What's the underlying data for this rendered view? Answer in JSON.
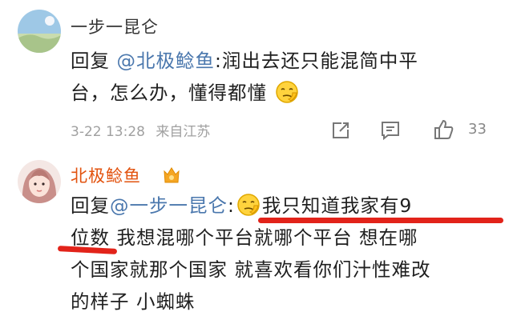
{
  "comments": [
    {
      "username": "一步一昆仑",
      "reply_prefix": "回复 ",
      "mention": "@北极鲶鱼",
      "text_line1": ":润出去还只能混简中平",
      "text_line2": "台，怎么办，懂得都懂",
      "timestamp": "3-22 13:28",
      "source": "来自江苏",
      "like_count": "33",
      "icons": [
        "share-icon",
        "comment-icon",
        "like-icon"
      ]
    },
    {
      "username": "北极鲶鱼",
      "badge": "vip-crown-badge",
      "reply_prefix": "回复",
      "mention": "@一步一昆仑",
      "text_line1": "我只知道我家有9",
      "text_line2a": "位数",
      "text_line2b": " 我想混哪个平台就哪个平台 想在哪",
      "text_line3": "个国家就那个国家 就喜欢看你们汁性难改",
      "text_line4": "的样子 小蜘蛛"
    }
  ],
  "colors": {
    "mention": "#4a77ad",
    "username_highlight": "#e2520e",
    "underline": "#e2231a",
    "meta": "#a0a0a0"
  }
}
